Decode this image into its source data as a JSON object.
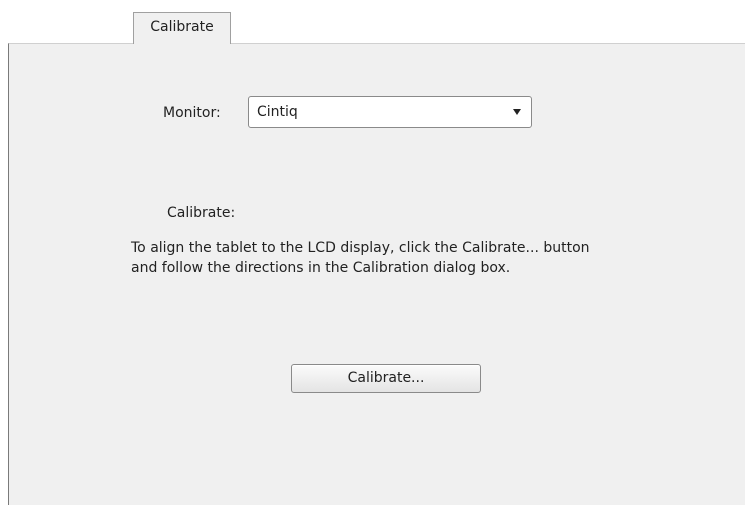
{
  "tab": {
    "label": "Calibrate"
  },
  "monitor": {
    "label": "Monitor:",
    "selected": "Cintiq"
  },
  "calibrate": {
    "heading": "Calibrate:",
    "description_lines": [
      "To align the tablet to the LCD display, click the Calibrate... button",
      "and follow the directions in the Calibration dialog box."
    ],
    "button_label": "Calibrate..."
  },
  "icons": {
    "dropdown": "chevron-down-icon"
  }
}
